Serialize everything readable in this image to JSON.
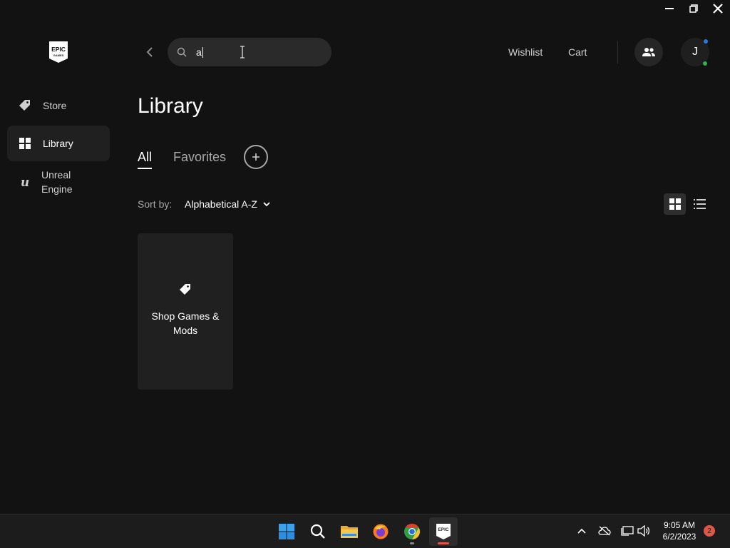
{
  "window_controls": {
    "minimize": "minimize",
    "restore": "restore",
    "close": "close"
  },
  "logo": {
    "line1": "EPIC",
    "line2": "GAMES"
  },
  "search": {
    "value": "a"
  },
  "header": {
    "wishlist_label": "Wishlist",
    "cart_label": "Cart",
    "avatar_initial": "J"
  },
  "sidebar": {
    "items": [
      {
        "label": "Store",
        "icon": "tag-icon",
        "active": false
      },
      {
        "label": "Library",
        "icon": "grid-icon",
        "active": true
      },
      {
        "label": "Unreal\nEngine",
        "icon": "unreal-icon",
        "active": false
      }
    ]
  },
  "main": {
    "title": "Library",
    "tabs": [
      {
        "label": "All",
        "active": true
      },
      {
        "label": "Favorites",
        "active": false
      }
    ],
    "sort_label": "Sort by:",
    "sort_value": "Alphabetical A-Z",
    "view_mode": "grid",
    "cards": [
      {
        "label": "Shop Games & Mods",
        "icon": "tag-icon"
      }
    ]
  },
  "taskbar": {
    "apps": [
      "windows-start",
      "search",
      "file-explorer",
      "firefox",
      "chrome",
      "epic-games-launcher"
    ],
    "active_app": "epic-games-launcher",
    "clock_time": "9:05 AM",
    "clock_date": "6/2/2023",
    "notification_count": "2"
  },
  "colors": {
    "background": "#121212",
    "surface": "#202020",
    "accent_blue": "#1e7de0",
    "online_green": "#2fb34b",
    "taskbar_indicator": "#e0574a"
  }
}
